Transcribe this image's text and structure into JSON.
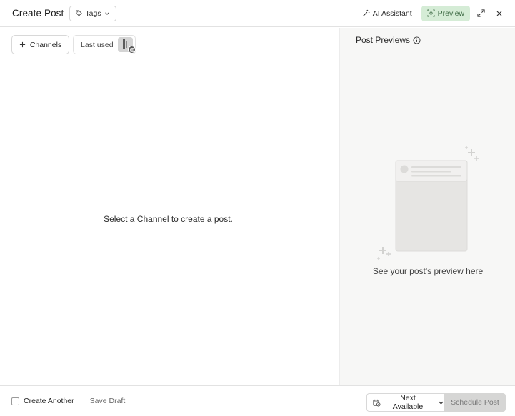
{
  "header": {
    "title": "Create Post",
    "tags_label": "Tags",
    "ai_assistant_label": "AI Assistant",
    "preview_label": "Preview"
  },
  "composer": {
    "channels_label": "Channels",
    "last_used_label": "Last used",
    "empty_message": "Select a Channel to create a post."
  },
  "previews": {
    "title": "Post Previews",
    "caption": "See your post's preview here"
  },
  "footer": {
    "create_another_label": "Create Another",
    "create_another_checked": false,
    "save_draft_label": "Save Draft",
    "schedule_option": "Next Available",
    "schedule_button_label": "Schedule Post"
  },
  "colors": {
    "preview_bg": "#d5ecd6",
    "preview_text": "#3e6b45",
    "right_pane_bg": "#f7f7f6",
    "schedule_disabled_bg": "#d6d6d5"
  }
}
